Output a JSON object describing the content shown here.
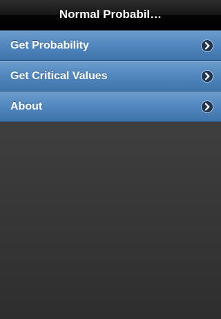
{
  "header": {
    "title": "Normal Probabil…"
  },
  "menu": {
    "items": [
      {
        "label": "Get Probability",
        "icon": "chevron-right-icon"
      },
      {
        "label": "Get Critical Values",
        "icon": "chevron-right-icon"
      },
      {
        "label": "About",
        "icon": "chevron-right-icon"
      }
    ]
  },
  "colors": {
    "header_background": "#000000",
    "menu_item_blue": "#4f86bd",
    "body_background": "#3a3a3a",
    "chevron_circle": "#1f3550"
  }
}
